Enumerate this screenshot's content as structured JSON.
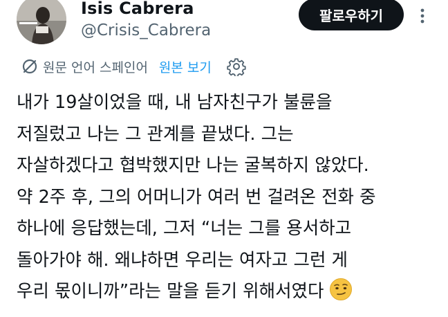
{
  "author": {
    "name": "Isis Cabrera",
    "handle": "@Crisis_Cabrera",
    "avatar_icon": "avatar-photo"
  },
  "follow_label": "팔로우하기",
  "more_icon": "more-options-icon",
  "translation": {
    "note": "원문 언어 스페인어",
    "show_original": "원본 보기",
    "translate_icon": "translate-icon",
    "settings_icon": "gear-icon"
  },
  "tweet": {
    "lines": [
      "내가 19살이었을 때, 내 남자친구가 불륜을",
      "저질렀고 나는 그 관계를 끝냈다. 그는",
      "자살하겠다고 협박했지만 나는 굴복하지 않았다.",
      "약 2주 후, 그의 어머니가 여러 번 걸려온 전화 중",
      "하나에 응답했는데, 그저 “너는 그를 용서하고",
      "돌아가야 해. 왜냐하면 우리는 여자고 그런 게",
      "우리 몫이니까”라는 말을 듣기 위해서였다"
    ],
    "emoji": "smirking-face-emoji"
  },
  "colors": {
    "text": "#0f1419",
    "secondary": "#536471",
    "link": "#1d9bf0",
    "button_bg": "#0f1419"
  }
}
